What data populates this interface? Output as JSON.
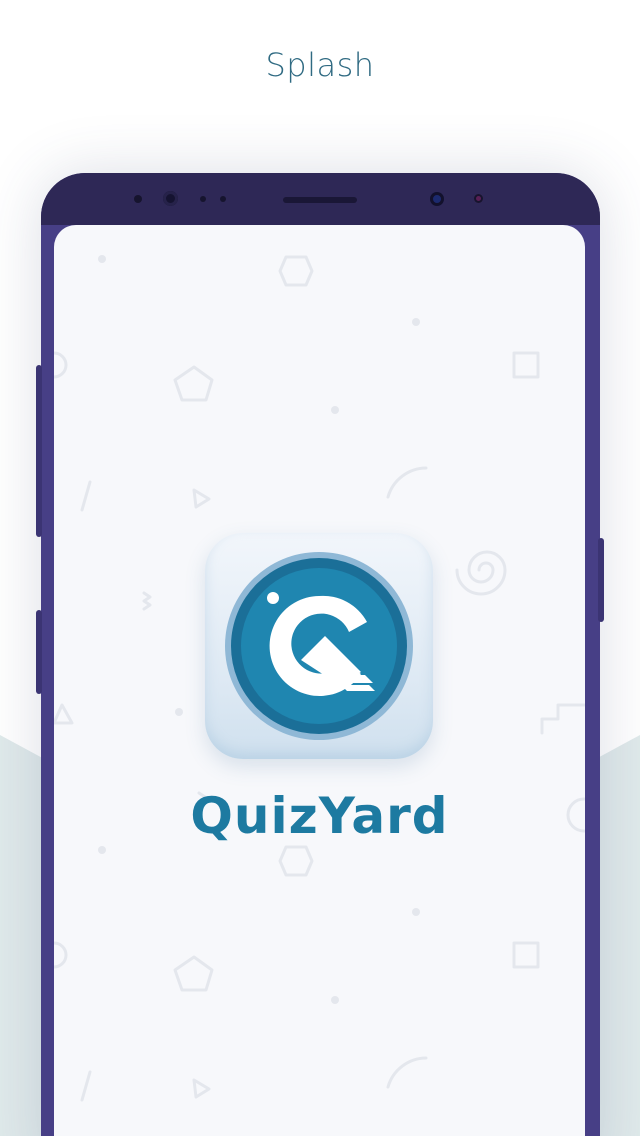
{
  "page": {
    "title": "Splash"
  },
  "app": {
    "name": "QuizYard",
    "logo_icon": "quiz-q-icon"
  },
  "colors": {
    "title_text": "#2f6a82",
    "phone_body": "#473f86",
    "phone_top": "#2e2856",
    "screen_bg": "#f7f8fb",
    "brand_blue": "#1d7aa1",
    "logo_ring": "#1b6f98",
    "background_band": "#dfe9ea"
  }
}
